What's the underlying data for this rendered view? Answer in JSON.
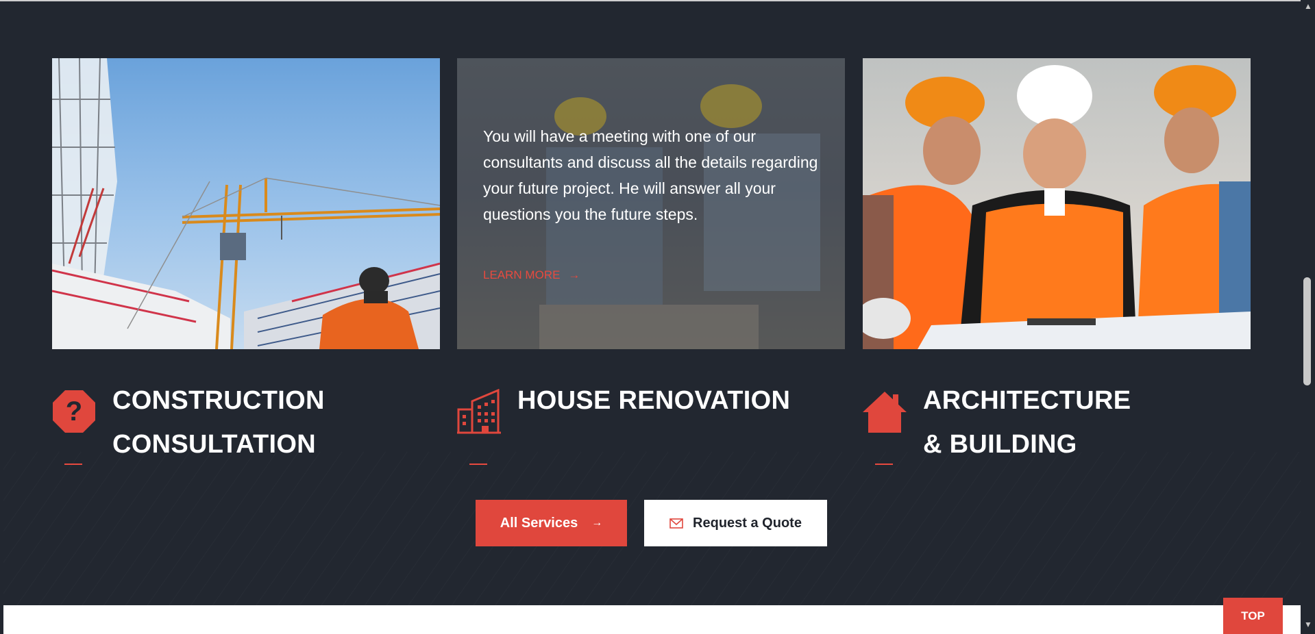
{
  "cards": [
    {
      "name": "crane-image"
    },
    {
      "name": "consultation-overlay",
      "text": "You will have a meeting with one of our consultants and discuss all the details regarding your future project. He will answer all your questions you the future steps.",
      "link": "LEARN MORE"
    },
    {
      "name": "architects-image"
    }
  ],
  "services": [
    {
      "title_line1": "CONSTRUCTION",
      "title_line2": "CONSULTATION",
      "icon": "question-octagon-icon"
    },
    {
      "title_line1": "HOUSE RENOVATION",
      "title_line2": "",
      "icon": "building-icon"
    },
    {
      "title_line1": "ARCHITECTURE",
      "title_line2": "& BUILDING",
      "icon": "house-icon"
    }
  ],
  "buttons": {
    "all_services": "All Services",
    "request_quote": "Request a Quote",
    "top": "TOP"
  },
  "colors": {
    "accent": "#e0473d",
    "background": "#222730"
  }
}
